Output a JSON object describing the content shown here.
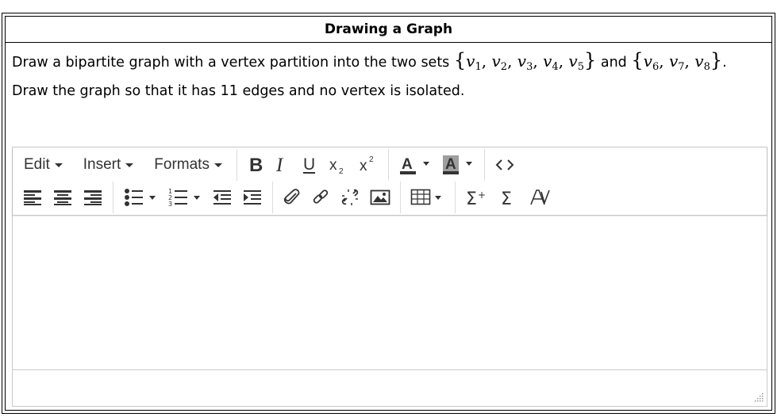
{
  "question": {
    "title": "Drawing a Graph",
    "text_before": "Draw a bipartite graph with a vertex partition into the two sets ",
    "set1": "v",
    "set1_subs": [
      "1",
      "2",
      "3",
      "4",
      "5"
    ],
    "text_middle": " and ",
    "set2_subs": [
      "6",
      "7",
      "8"
    ],
    "text_after": ". Draw the graph so that it has 11 edges and no vertex is isolated."
  },
  "editor": {
    "menus": {
      "edit": "Edit",
      "insert": "Insert",
      "formats": "Formats"
    },
    "toolbar_row1": [
      "bold-icon",
      "italic-icon",
      "underline-icon",
      "subscript-icon",
      "superscript-icon",
      "text-color-icon",
      "background-color-icon",
      "code-icon"
    ],
    "toolbar_row2": [
      "align-left-icon",
      "align-center-icon",
      "align-right-icon",
      "bullet-list-icon",
      "numbered-list-icon",
      "outdent-icon",
      "indent-icon",
      "attachment-icon",
      "link-icon",
      "unlink-icon",
      "image-icon",
      "table-icon",
      "sum-plus-icon",
      "sum-icon",
      "strikethrough-a-icon"
    ],
    "content": ""
  }
}
